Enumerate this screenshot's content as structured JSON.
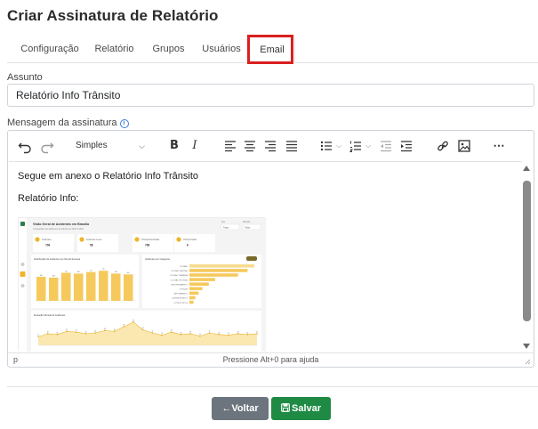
{
  "page": {
    "title": "Criar Assinatura de Relatório"
  },
  "tabs": [
    {
      "label": "Configuração",
      "active": false
    },
    {
      "label": "Relatório",
      "active": false
    },
    {
      "label": "Grupos",
      "active": false
    },
    {
      "label": "Usuários",
      "active": false
    },
    {
      "label": "Email",
      "active": true
    }
  ],
  "form": {
    "subject_label": "Assunto",
    "subject_value": "Relatório Info Trânsito",
    "message_label": "Mensagem da assinatura",
    "info_icon": "i"
  },
  "editor": {
    "format_select": "Simples",
    "status_path": "p",
    "status_help": "Pressione Alt+0 para ajuda",
    "lines": [
      "Segue em anexo o Relatório Info Trânsito",
      "Relatório Info:"
    ],
    "embedded_report": {
      "header_title": "Visão Geral de Acidentes em Brasília",
      "header_subtitle": "Comparativo de acidentes de trânsito de 2023 a 2024",
      "filter1_label": "Ano",
      "filter1_value": "Todos",
      "filter2_label": "Período",
      "filter2_value": "Todos",
      "kpis": [
        {
          "label": "Acidentes",
          "value": "706"
        },
        {
          "label": "Acidentes Leves",
          "value": "58"
        },
        {
          "label": "Vítimas Envolvidas",
          "value": "768"
        },
        {
          "label": "Vítimas Fatais",
          "value": "6"
        }
      ],
      "bar_chart_title": "Distribuição de Acidentes por Dia da Semana",
      "bar_values": [
        60,
        58,
        70,
        68,
        72,
        75,
        68,
        66
      ],
      "hbar_chart_title": "Acidentes por Categoria",
      "hbar_categories": [
        "COLISÃO",
        "COLISÃO LATERAL",
        "COLISÃO TRASEIRA",
        "COLISÃO FRONTAL",
        "ATROPELAMENTO",
        "CHOQUE",
        "CAPOTAMENTO",
        "QUEDA DE MOTO",
        "OUTROS TIPOS"
      ],
      "hbar_values": [
        240,
        215,
        180,
        95,
        72,
        48,
        34,
        22,
        15
      ],
      "line_chart_title": "Evolução Mensal de Acidentes",
      "line_values": [
        22,
        30,
        28,
        36,
        34,
        30,
        32,
        38,
        36,
        48,
        60,
        40,
        32,
        26,
        34,
        28,
        30,
        24,
        32,
        28,
        26,
        30,
        28,
        30
      ]
    }
  },
  "buttons": {
    "back": "Voltar",
    "save": "Salvar"
  },
  "colors": {
    "highlight": "#d91f1f",
    "back_button": "#6c757d",
    "save_button": "#1e8a44",
    "chart_bar": "#f5c95c"
  }
}
